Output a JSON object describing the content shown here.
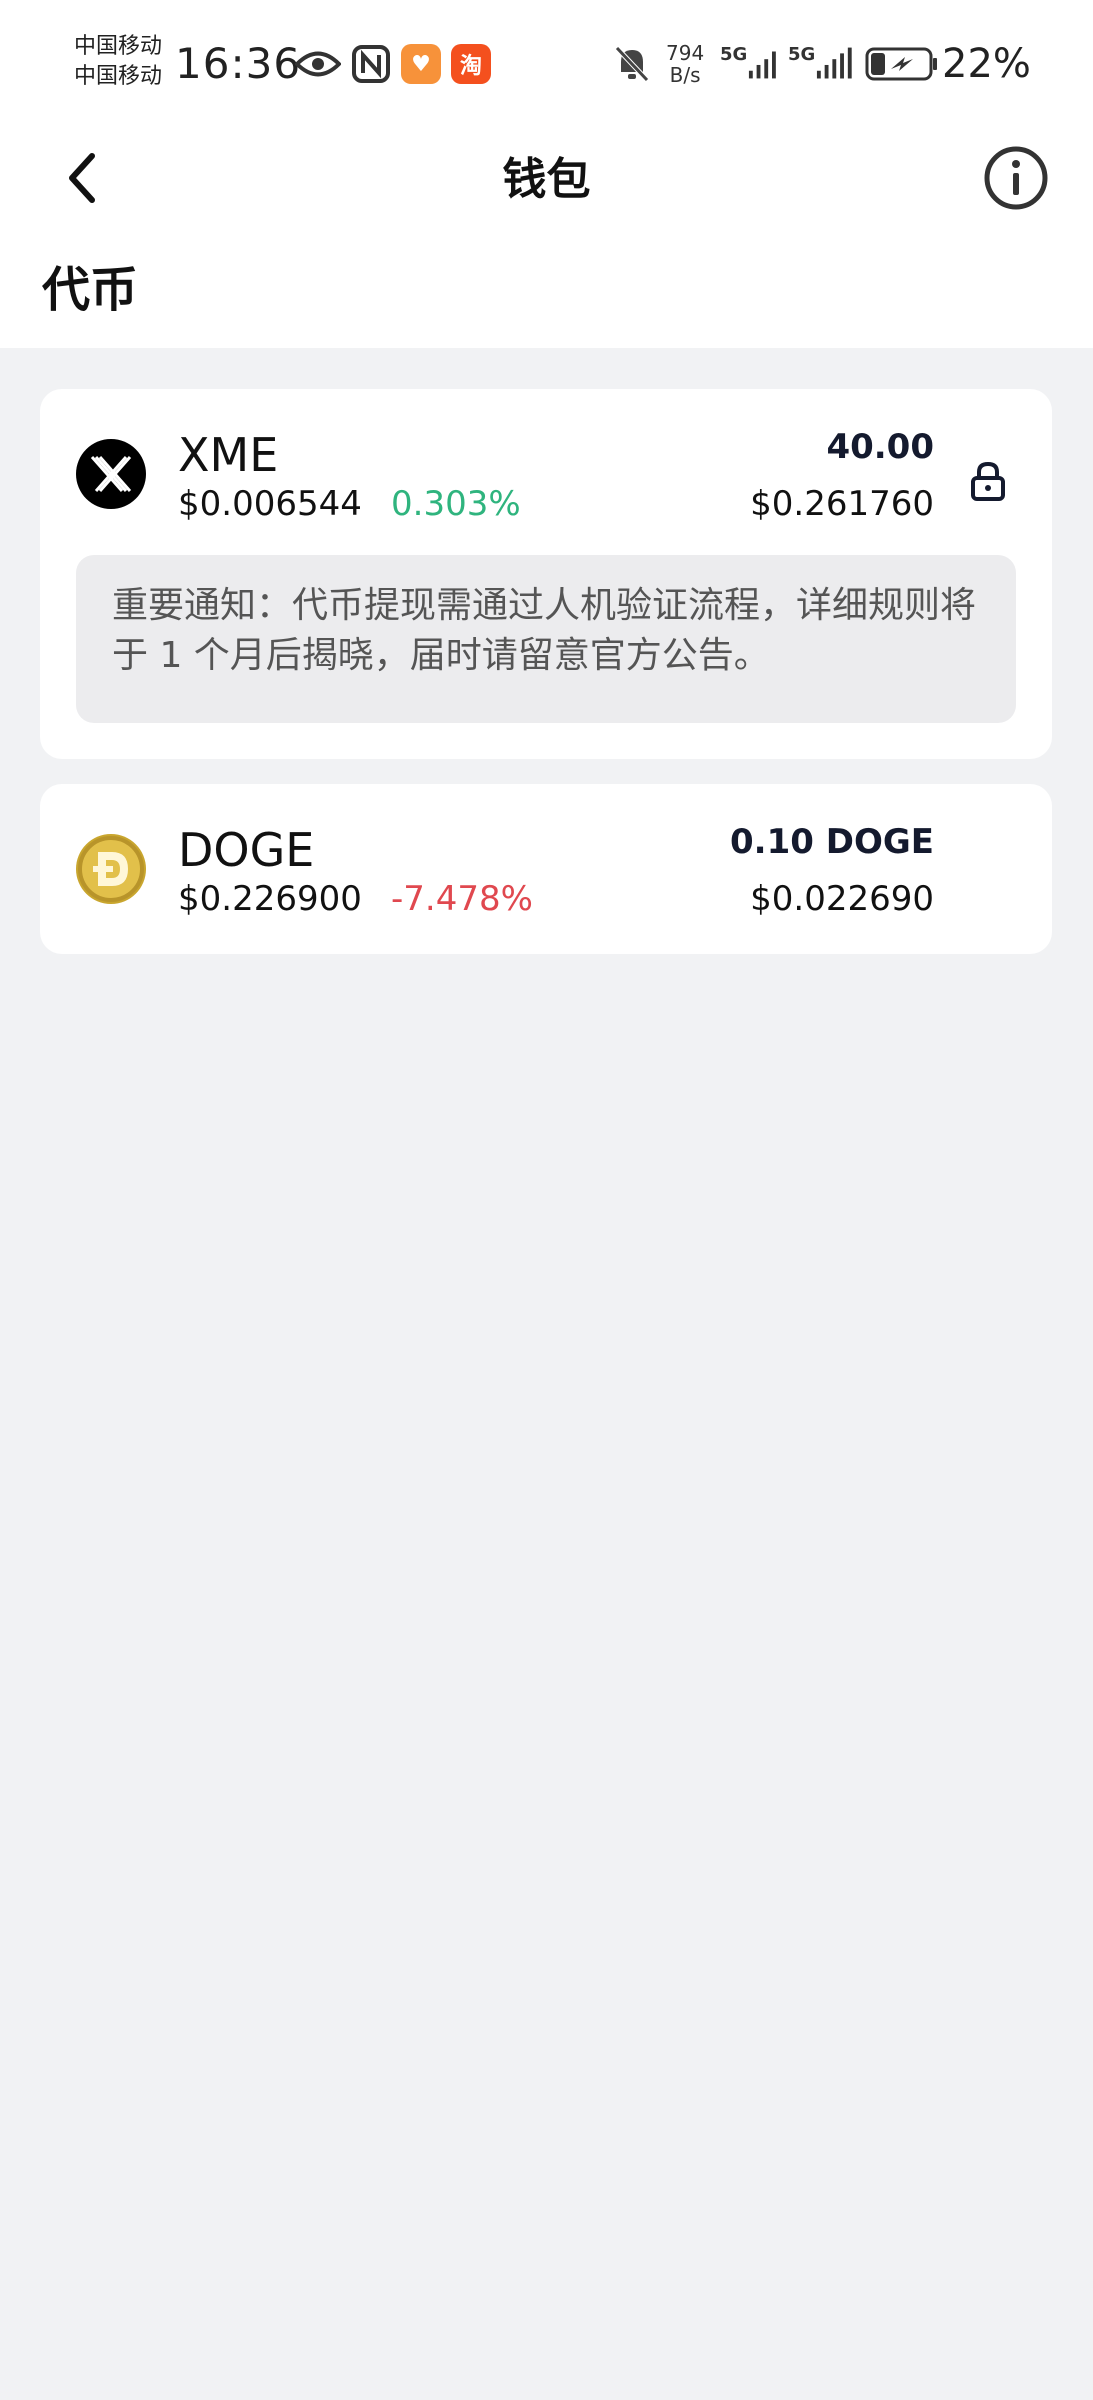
{
  "status_bar": {
    "carrier_1": "中国移动",
    "carrier_2": "中国移动",
    "time": "16:36",
    "net_speed_value": "794",
    "net_speed_unit": "B/s",
    "signal_1_label": "5G",
    "signal_2_label": "5G",
    "battery_percent": "22%",
    "icons": [
      "eye-icon",
      "nfc-icon",
      "app-heart-icon",
      "app-taobao-icon",
      "mute-bell-icon",
      "signal-icon",
      "battery-charging-icon"
    ]
  },
  "nav": {
    "title": "钱包",
    "back_icon": "chevron-left-icon",
    "info_icon": "info-circle-icon"
  },
  "section": {
    "title": "代币"
  },
  "tokens": [
    {
      "symbol": "XME",
      "price": "$0.006544",
      "change": "0.303%",
      "change_direction": "up",
      "amount": "40.00",
      "value": "$0.261760",
      "locked": true,
      "notice": "重要通知：代币提现需通过人机验证流程，详细规则将于 1 个月后揭晓，届时请留意官方公告。"
    },
    {
      "symbol": "DOGE",
      "price": "$0.226900",
      "change": "-7.478%",
      "change_direction": "down",
      "amount": "0.10 DOGE",
      "value": "$0.022690",
      "locked": false
    }
  ],
  "colors": {
    "up": "#2fb47e",
    "down": "#e0484f",
    "background": "#f1f2f4",
    "card": "#ffffff",
    "notice_bg": "#ececee"
  }
}
